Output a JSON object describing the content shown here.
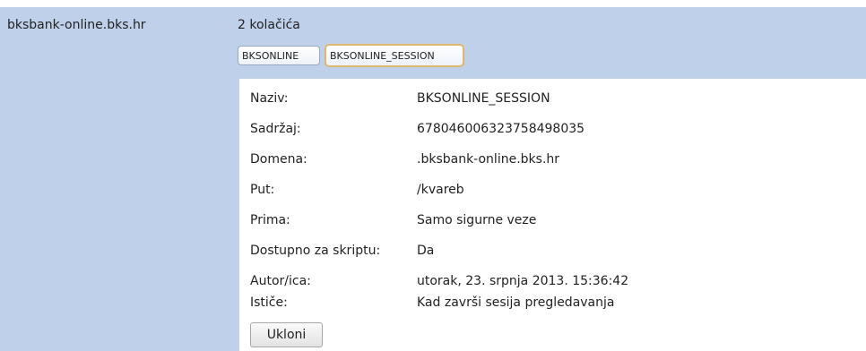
{
  "site": {
    "domain": "bksbank-online.bks.hr",
    "cookie_count": "2 kolačića"
  },
  "cookies": [
    {
      "name": "BKSONLINE"
    },
    {
      "name": "BKSONLINE_SESSION",
      "selected": true
    }
  ],
  "details": {
    "rows": [
      {
        "label": "Naziv:",
        "value": "BKSONLINE_SESSION"
      },
      {
        "label": "Sadržaj:",
        "value": "678046006323758498035"
      },
      {
        "label": "Domena:",
        "value": ".bksbank-online.bks.hr"
      },
      {
        "label": "Put:",
        "value": "/kvareb"
      },
      {
        "label": "Prima:",
        "value": "Samo sigurne veze"
      },
      {
        "label": "Dostupno za skriptu:",
        "value": "Da"
      },
      {
        "label": "Autor/ica:",
        "value": "utorak, 23. srpnja 2013. 15:36:42"
      },
      {
        "label": "Ističe:",
        "value": "Kad završi sesija pregledavanja"
      }
    ],
    "remove_label": "Ukloni"
  },
  "colors": {
    "row_highlight": "#bed0ea",
    "selected_chip_border": "#e0b86b"
  }
}
